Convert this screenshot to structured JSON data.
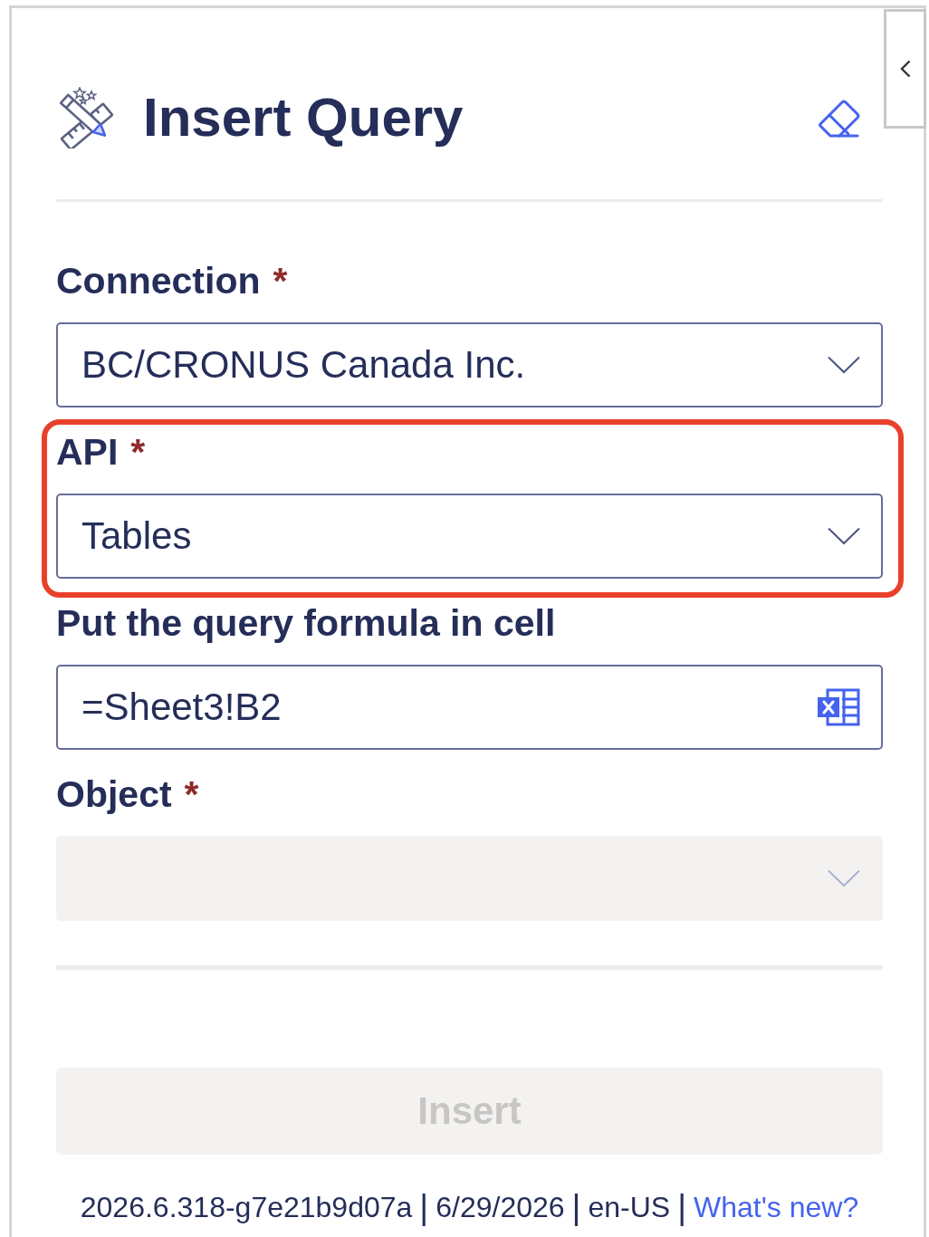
{
  "header": {
    "title": "Insert Query"
  },
  "fields": [
    {
      "kind": "select",
      "label": "Connection",
      "required_mark": "*",
      "value": "BC/CRONUS Canada Inc.",
      "disabled": false,
      "highlighted": false
    },
    {
      "kind": "select",
      "label": "API",
      "required_mark": "*",
      "value": "Tables",
      "disabled": false,
      "highlighted": true
    },
    {
      "kind": "cell_reference",
      "label": "Put the query formula in cell",
      "value": "=Sheet3!B2",
      "disabled": false,
      "highlighted": false
    },
    {
      "kind": "select",
      "label": "Object",
      "required_mark": "*",
      "disabled": true,
      "highlighted": false
    }
  ],
  "insert_button": {
    "label": "Insert",
    "disabled": true
  },
  "footer": {
    "separator": "|",
    "items": [
      {
        "kind": "text",
        "text": "2026.6.318-g7e21b9d07a"
      },
      {
        "kind": "text",
        "text": "6/29/2026"
      },
      {
        "kind": "text",
        "text": "en-US"
      },
      {
        "kind": "link",
        "text": "What's new?"
      }
    ]
  }
}
